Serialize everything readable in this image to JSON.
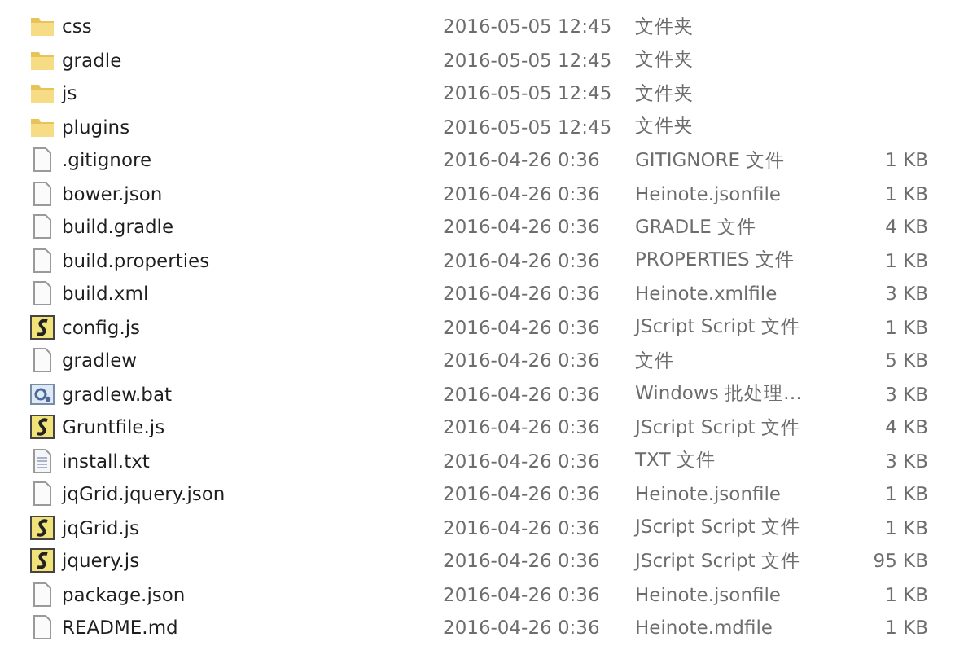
{
  "files": [
    {
      "kind": "folder",
      "name": "css",
      "modified": "2016-05-05 12:45",
      "type": "文件夹"
    },
    {
      "kind": "folder",
      "name": "gradle",
      "modified": "2016-05-05 12:45",
      "type": "文件夹"
    },
    {
      "kind": "folder",
      "name": "js",
      "modified": "2016-05-05 12:45",
      "type": "文件夹"
    },
    {
      "kind": "folder",
      "name": "plugins",
      "modified": "2016-05-05 12:45",
      "type": "文件夹"
    },
    {
      "kind": "file",
      "name": ".gitignore",
      "modified": "2016-04-26 0:36",
      "type": "GITIGNORE 文件",
      "size": "1 KB"
    },
    {
      "kind": "file",
      "name": "bower.json",
      "modified": "2016-04-26 0:36",
      "type": "Heinote.jsonfile",
      "size": "1 KB"
    },
    {
      "kind": "file",
      "name": "build.gradle",
      "modified": "2016-04-26 0:36",
      "type": "GRADLE 文件",
      "size": "4 KB"
    },
    {
      "kind": "file",
      "name": "build.properties",
      "modified": "2016-04-26 0:36",
      "type": "PROPERTIES 文件",
      "size": "1 KB"
    },
    {
      "kind": "file",
      "name": "build.xml",
      "modified": "2016-04-26 0:36",
      "type": "Heinote.xmlfile",
      "size": "3 KB"
    },
    {
      "kind": "script",
      "name": "config.js",
      "modified": "2016-04-26 0:36",
      "type": "JScript Script 文件",
      "size": "1 KB"
    },
    {
      "kind": "file",
      "name": "gradlew",
      "modified": "2016-04-26 0:36",
      "type": "文件",
      "size": "5 KB"
    },
    {
      "kind": "batch",
      "name": "gradlew.bat",
      "modified": "2016-04-26 0:36",
      "type": "Windows 批处理…",
      "size": "3 KB"
    },
    {
      "kind": "script",
      "name": "Gruntfile.js",
      "modified": "2016-04-26 0:36",
      "type": "JScript Script 文件",
      "size": "4 KB"
    },
    {
      "kind": "text",
      "name": "install.txt",
      "modified": "2016-04-26 0:36",
      "type": "TXT 文件",
      "size": "3 KB"
    },
    {
      "kind": "file",
      "name": "jqGrid.jquery.json",
      "modified": "2016-04-26 0:36",
      "type": "Heinote.jsonfile",
      "size": "1 KB"
    },
    {
      "kind": "script",
      "name": "jqGrid.js",
      "modified": "2016-04-26 0:36",
      "type": "JScript Script 文件",
      "size": "1 KB"
    },
    {
      "kind": "script",
      "name": "jquery.js",
      "modified": "2016-04-26 0:36",
      "type": "JScript Script 文件",
      "size": "95 KB"
    },
    {
      "kind": "file",
      "name": "package.json",
      "modified": "2016-04-26 0:36",
      "type": "Heinote.jsonfile",
      "size": "1 KB"
    },
    {
      "kind": "file",
      "name": "README.md",
      "modified": "2016-04-26 0:36",
      "type": "Heinote.mdfile",
      "size": "1 KB"
    }
  ]
}
